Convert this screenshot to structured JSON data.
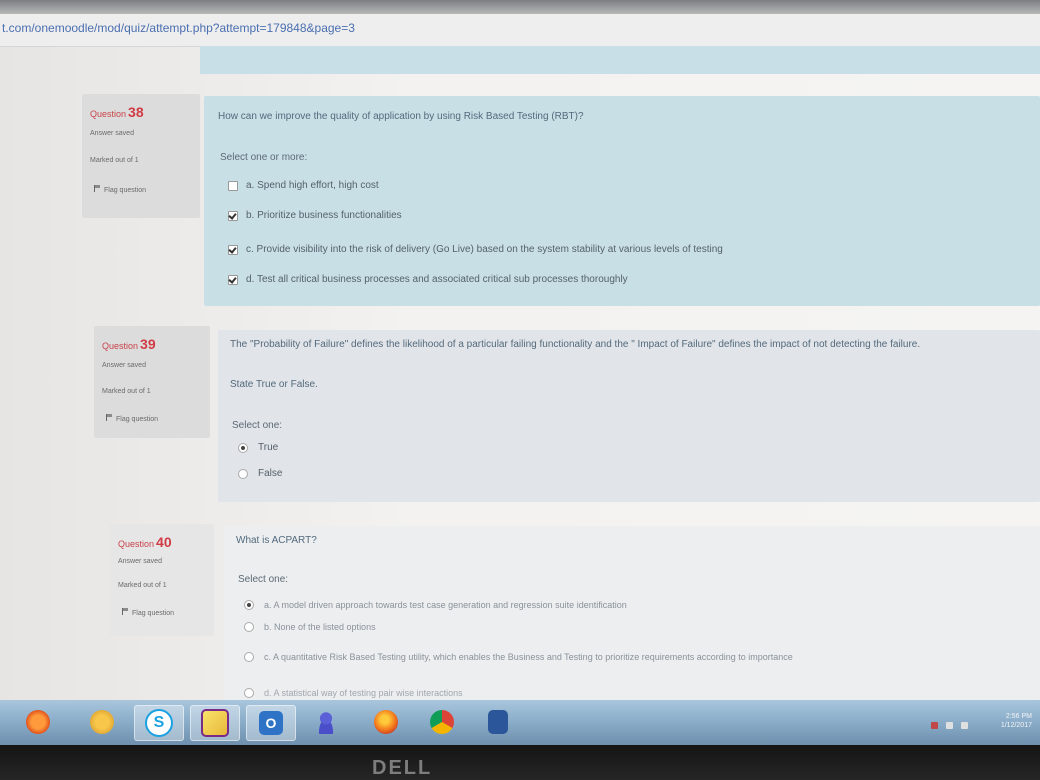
{
  "browser": {
    "url": "t.com/onemoodle/mod/quiz/attempt.php?attempt=179848&page=3"
  },
  "questions": [
    {
      "label": "Question",
      "number": "38",
      "state": "Answer saved",
      "marks": "Marked out of 1",
      "flag": "Flag question",
      "text": "How can we improve the quality of application by using Risk Based Testing (RBT)?",
      "prompt": "Select one or more:",
      "options": [
        {
          "label": "a. Spend high effort, high cost",
          "checked": false
        },
        {
          "label": "b. Prioritize business functionalities",
          "checked": true
        },
        {
          "label": "c. Provide visibility into the risk of delivery (Go Live) based on the system stability at various levels of testing",
          "checked": true
        },
        {
          "label": "d. Test all critical business processes and associated critical sub processes thoroughly",
          "checked": true
        }
      ]
    },
    {
      "label": "Question",
      "number": "39",
      "state": "Answer saved",
      "marks": "Marked out of 1",
      "flag": "Flag question",
      "text": "The \"Probability of Failure\" defines the likelihood of a particular failing functionality and the \" Impact of Failure\" defines the impact of not detecting the failure.",
      "text2": "State True or False.",
      "prompt": "Select one:",
      "options": [
        {
          "label": "True",
          "checked": true
        },
        {
          "label": "False",
          "checked": false
        }
      ]
    },
    {
      "label": "Question",
      "number": "40",
      "state": "Answer saved",
      "marks": "Marked out of 1",
      "flag": "Flag question",
      "text": "What is ACPART?",
      "prompt": "Select one:",
      "options": [
        {
          "label": "a. A model driven approach towards test case generation and regression suite identification",
          "checked": true
        },
        {
          "label": "b. None of the listed options",
          "checked": false
        },
        {
          "label": "c. A quantitative Risk Based Testing utility, which enables the Business and Testing to prioritize requirements according to importance",
          "checked": false
        },
        {
          "label": "d. A statistical way of testing pair wise interactions",
          "checked": false
        }
      ]
    }
  ],
  "taskbar": {
    "apps": [
      "media-player",
      "file-explorer",
      "skype",
      "sticky-notes",
      "outlook",
      "user-app",
      "firefox",
      "chrome",
      "word"
    ],
    "time": "2:56 PM",
    "date": "1/12/2017"
  },
  "bezel": {
    "brand": "DELL"
  },
  "colors": {
    "question_number": "#d13b45",
    "content_blue": "#c9dfe6",
    "content_gray": "#e3e6e9",
    "info_bg": "#dcdcdc"
  }
}
